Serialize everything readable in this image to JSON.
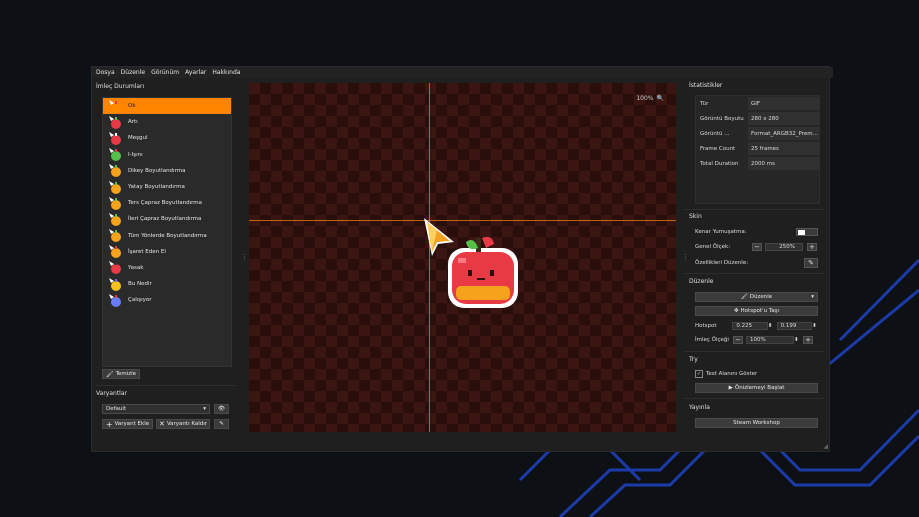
{
  "menu": [
    "Dosya",
    "Düzenle",
    "Görünüm",
    "Ayarlar",
    "Hakkında"
  ],
  "cursor_states": {
    "title": "İmleç Durumları",
    "items": [
      {
        "label": "Ok",
        "selected": true
      },
      {
        "label": "Artı"
      },
      {
        "label": "Meşgul"
      },
      {
        "label": "I-Işını"
      },
      {
        "label": "Dikey Boyutlandırma"
      },
      {
        "label": "Yatay Boyutlandırma"
      },
      {
        "label": "Ters Çapraz Boyutlandırma"
      },
      {
        "label": "İleri Çapraz Boyutlandırma"
      },
      {
        "label": "Tüm Yönlerde Boyutlandırma"
      },
      {
        "label": "İşaret Eden El"
      },
      {
        "label": "Yasak"
      },
      {
        "label": "Bu Nedir"
      },
      {
        "label": "Çalışıyor"
      }
    ],
    "clear_label": "Temizle"
  },
  "variants": {
    "title": "Varyantlar",
    "selected": "Default",
    "add_label": "Varyant Ekle",
    "remove_label": "Varyantı Kaldır"
  },
  "canvas": {
    "zoom": "100%"
  },
  "stats": {
    "title": "İstatistikler",
    "rows": [
      {
        "k": "Tür",
        "v": "GIF"
      },
      {
        "k": "Görüntü Boyutu",
        "v": "280 x 280"
      },
      {
        "k": "Görüntü ...",
        "v": "Format_ARGB32_Prem..."
      },
      {
        "k": "Frame Count",
        "v": "25 frames"
      },
      {
        "k": "Total Duration",
        "v": "2000 ms"
      }
    ]
  },
  "skin": {
    "title": "Skin",
    "smoothing_label": "Kenar Yumuşatma:",
    "scale_label": "Genel Ölçek:",
    "scale_value": "250%",
    "props_label": "Özellikleri Düzenle:"
  },
  "edit": {
    "title": "Düzenle",
    "dropdown_label": "Düzenle",
    "move_hotspot_label": "Hotspot'u Taşı",
    "hotspot_label": "Hotspot",
    "hotspot_x": "0.225",
    "hotspot_y": "0.199",
    "cursor_scale_label": "İmleç Ölçeği",
    "cursor_scale_value": "100%"
  },
  "try": {
    "title": "Try",
    "show_test_label": "Test Alanını Göster",
    "start_preview_label": "Önizlemeyi Başlat"
  },
  "publish": {
    "title": "Yayınla",
    "workshop_label": "Steam Workshop"
  },
  "colors": {
    "accent": "#ff8400",
    "guide": "#e07b1a"
  }
}
